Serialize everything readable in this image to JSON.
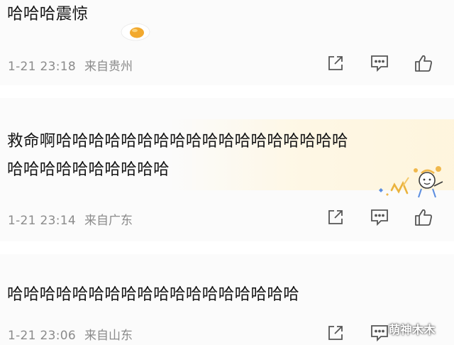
{
  "comments": [
    {
      "lines": [
        "哈哈哈震惊"
      ],
      "time": "1-21 23:18",
      "location": "来自贵州",
      "sticker": "fried-egg-sticker"
    },
    {
      "lines": [
        "救命啊哈哈哈哈哈哈哈哈哈哈哈哈哈哈哈哈哈哈",
        "哈哈哈哈哈哈哈哈哈哈"
      ],
      "time": "1-21 23:14",
      "location": "来自广东",
      "sticker": "cheering-cartoon-sticker"
    },
    {
      "lines": [
        "哈哈哈哈哈哈哈哈哈哈哈哈哈哈哈哈哈哈"
      ],
      "time": "1-21 23:06",
      "location": "来自山东"
    }
  ],
  "actions": {
    "share_icon": "share-icon",
    "comment_icon": "comment-icon",
    "like_icon": "thumbs-up-icon"
  },
  "watermark": "萌神木木",
  "colors": {
    "text": "#151515",
    "meta": "#8b8b8b",
    "icon": "#555555",
    "card_background": "#fbfbfb",
    "divider": "#ffffff"
  }
}
